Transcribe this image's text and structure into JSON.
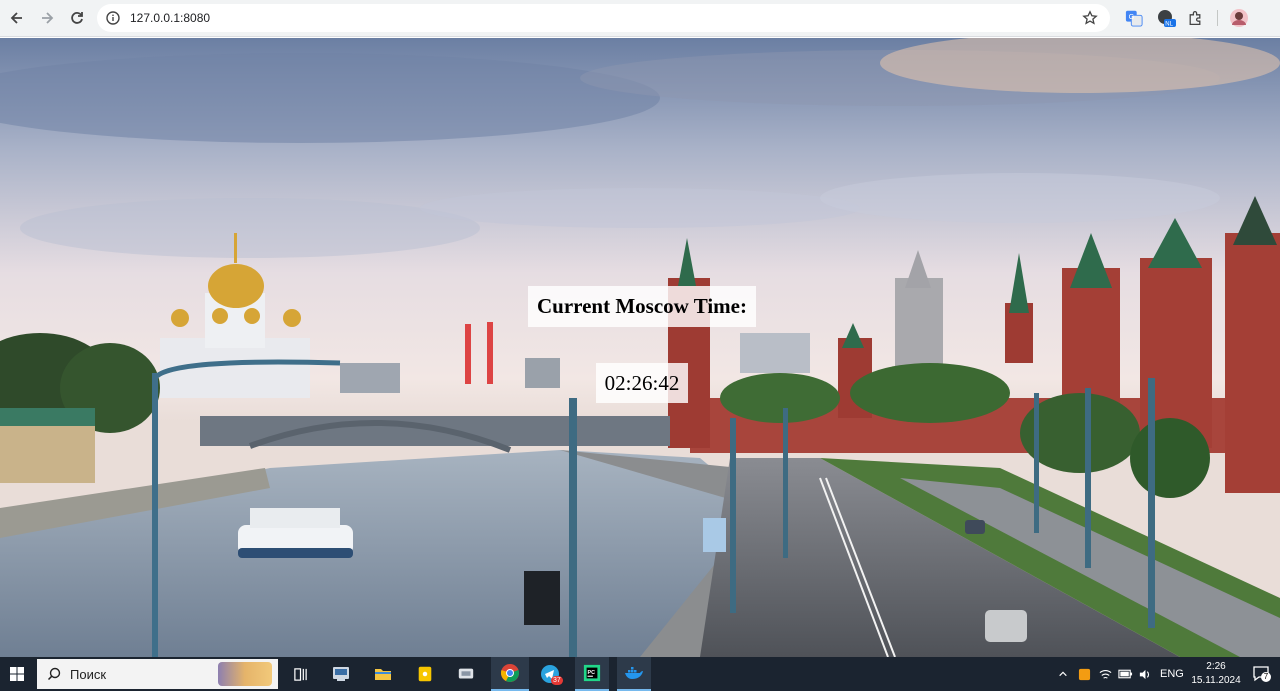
{
  "browser": {
    "url": "127.0.0.1:8080",
    "buttons": {
      "back": "back-arrow-icon",
      "forward": "forward-arrow-icon",
      "reload": "reload-icon",
      "site_info": "info-icon",
      "bookmark": "star-icon"
    },
    "extensions": [
      "translate-icon",
      "nl-extension-icon",
      "puzzle-icon",
      "profile-avatar-icon"
    ]
  },
  "page": {
    "heading": "Current Moscow Time:",
    "time": "02:26:42"
  },
  "taskbar": {
    "search_placeholder": "Поиск",
    "apps": [
      "task-view-icon",
      "app-icon",
      "file-explorer-icon",
      "sticky-notes-icon",
      "app-icon",
      "chrome-icon",
      "telegram-icon",
      "pycharm-icon",
      "docker-icon"
    ],
    "telegram_badge": "37",
    "tray": {
      "language": "ENG",
      "time": "2:26",
      "date": "15.11.2024",
      "notifications": "7"
    }
  },
  "colors": {
    "chrome_bg": "#f1f3f4",
    "taskbar_bg": "#1b2430",
    "accent": "#76b9ed"
  }
}
